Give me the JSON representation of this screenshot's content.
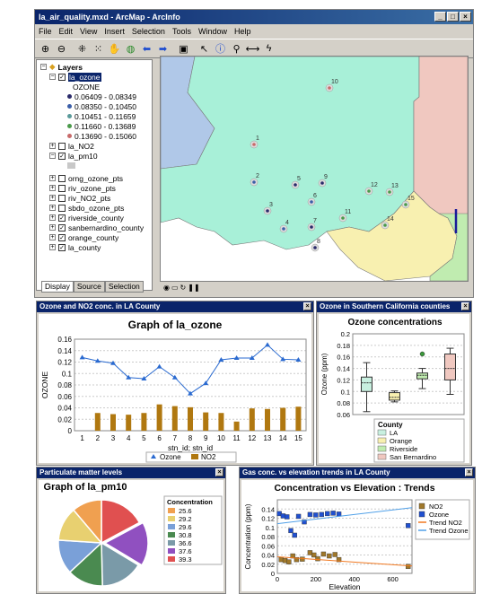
{
  "window": {
    "title": "la_air_quality.mxd - ArcMap - ArcInfo",
    "buttons": [
      "_",
      "□",
      "×"
    ]
  },
  "menu": [
    "File",
    "Edit",
    "View",
    "Insert",
    "Selection",
    "Tools",
    "Window",
    "Help"
  ],
  "toolbar_icons": [
    "zoom-in-icon",
    "zoom-out-icon",
    "fixed-zoom-in-icon",
    "fixed-zoom-out-icon",
    "pan-icon",
    "full-extent-icon",
    "back-icon",
    "forward-icon",
    "bookmark-icon",
    "select-arrow-icon",
    "identify-icon",
    "find-icon",
    "measure-icon",
    "hyperlink-icon"
  ],
  "toc": {
    "root": "Layers",
    "layers": [
      {
        "name": "la_ozone",
        "checked": true,
        "expanded": true,
        "selected": true
      },
      {
        "name": "la_NO2",
        "checked": false,
        "expanded": false
      },
      {
        "name": "la_pm10",
        "checked": true,
        "expanded": true
      },
      {
        "name": "orng_ozone_pts",
        "checked": false,
        "expanded": false
      },
      {
        "name": "riv_ozone_pts",
        "checked": false,
        "expanded": false
      },
      {
        "name": "riv_NO2_pts",
        "checked": false,
        "expanded": false
      },
      {
        "name": "sbdo_ozone_pts",
        "checked": false,
        "expanded": false
      },
      {
        "name": "riverside_county",
        "checked": true,
        "expanded": false
      },
      {
        "name": "sanbernardino_county",
        "checked": true,
        "expanded": false
      },
      {
        "name": "orange_county",
        "checked": true,
        "expanded": false
      },
      {
        "name": "la_county",
        "checked": true,
        "expanded": false
      }
    ],
    "ozone_field": "OZONE",
    "ozone_classes": [
      {
        "label": "0.06409 - 0.08349",
        "color": "#2a2a6a"
      },
      {
        "label": "0.08350 - 0.10450",
        "color": "#3a5ea8"
      },
      {
        "label": "0.10451 - 0.11659",
        "color": "#5a9a9a"
      },
      {
        "label": "0.11660 - 0.13689",
        "color": "#4a9a4a"
      },
      {
        "label": "0.13690 - 0.15060",
        "color": "#c86a6a"
      }
    ],
    "tabs": [
      "Display",
      "Source",
      "Selection"
    ]
  },
  "map": {
    "stations": [
      "1",
      "2",
      "3",
      "4",
      "5",
      "6",
      "7",
      "8",
      "9",
      "10",
      "11",
      "12",
      "13",
      "14",
      "15"
    ],
    "colors": {
      "la": "#a8f0d8",
      "orange": "#f8f0b0",
      "riverside": "#c0ecb0",
      "sanbernardino": "#f0c8c0",
      "west": "#b0c8e8"
    }
  },
  "status_icons": [
    "data-view-icon",
    "layout-view-icon",
    "refresh-icon",
    "pause-icon"
  ],
  "chart_data": [
    {
      "panel_title": "Ozone and NO2 conc. in LA County",
      "type": "line",
      "title": "Graph of la_ozone",
      "xlabel": "stn_id; stn_id",
      "ylabel": "OZONE",
      "categories": [
        "1",
        "2",
        "3",
        "4",
        "5",
        "6",
        "7",
        "8",
        "9",
        "10",
        "11",
        "12",
        "13",
        "14",
        "15"
      ],
      "ylim": [
        0,
        0.16
      ],
      "yticks": [
        "0",
        "0.02",
        "0.04",
        "0.06",
        "0.08",
        "0.1",
        "0.12",
        "0.14",
        "0.16"
      ],
      "series": [
        {
          "name": "Ozone",
          "type": "line",
          "color": "#2a6ad0",
          "values": [
            0.128,
            0.122,
            0.118,
            0.093,
            0.091,
            0.112,
            0.093,
            0.065,
            0.083,
            0.124,
            0.127,
            0.127,
            0.15,
            0.125,
            0.124
          ]
        },
        {
          "name": "NO2",
          "type": "bar",
          "color": "#b07810",
          "values": [
            0,
            0.031,
            0.029,
            0.028,
            0.031,
            0.046,
            0.043,
            0.041,
            0.032,
            0.031,
            0.016,
            0.039,
            0.038,
            0.04,
            0.042
          ]
        }
      ],
      "grid": true,
      "legend": "bottom"
    },
    {
      "panel_title": "Ozone in Southern California counties",
      "type": "box",
      "title": "Ozone concentrations",
      "ylabel": "Ozone (ppm)",
      "ylim": [
        0.06,
        0.2
      ],
      "yticks": [
        "0.06",
        "0.08",
        "0.1",
        "0.12",
        "0.14",
        "0.16",
        "0.18",
        "0.2"
      ],
      "legend_title": "County",
      "legend": "bottom",
      "series": [
        {
          "name": "LA",
          "color": "#c8f0e0",
          "min": 0.065,
          "q1": 0.1,
          "median": 0.115,
          "q3": 0.125,
          "max": 0.15
        },
        {
          "name": "Orange",
          "color": "#f8f0b0",
          "min": 0.082,
          "q1": 0.085,
          "median": 0.09,
          "q3": 0.098,
          "max": 0.101
        },
        {
          "name": "Riverside",
          "color": "#c0ecb0",
          "min": 0.105,
          "q1": 0.122,
          "median": 0.128,
          "q3": 0.132,
          "max": 0.14,
          "outliers": [
            0.165
          ]
        },
        {
          "name": "San Bernardino",
          "color": "#f0c8c0",
          "min": 0.095,
          "q1": 0.12,
          "median": 0.14,
          "q3": 0.165,
          "max": 0.175
        }
      ],
      "grid": true
    },
    {
      "panel_title": "Particulate matter levels",
      "type": "pie",
      "title": "Graph of la_pm10",
      "legend_title": "Concentration",
      "legend": "right",
      "slices": [
        {
          "label": "25.6",
          "value": 25.6,
          "color": "#f0a050"
        },
        {
          "label": "29.2",
          "color": "#e8d070",
          "value": 29.2
        },
        {
          "label": "29.6",
          "color": "#7aa0d8",
          "value": 29.6
        },
        {
          "label": "30.8",
          "color": "#4a8a50",
          "value": 30.8
        },
        {
          "label": "36.6",
          "color": "#7a9aa8",
          "value": 36.6
        },
        {
          "label": "37.6",
          "color": "#9050c0",
          "value": 37.6
        },
        {
          "label": "39.3",
          "color": "#e05050",
          "value": 39.3
        }
      ]
    },
    {
      "panel_title": "Gas conc. vs elevation trends in LA County",
      "type": "scatter",
      "title": "Concentration vs Elevation : Trends",
      "xlabel": "Elevation",
      "ylabel": "Concentration (ppm)",
      "xlim": [
        0,
        700
      ],
      "ylim": [
        0,
        0.16
      ],
      "xticks": [
        "0",
        "200",
        "400",
        "600"
      ],
      "yticks": [
        "0",
        "0.02",
        "0.04",
        "0.06",
        "0.08",
        "0.1",
        "0.12",
        "0.14"
      ],
      "legend": "right",
      "series": [
        {
          "name": "NO2",
          "type": "scatter",
          "color": "#a0782a",
          "points": [
            [
              20,
              0.03
            ],
            [
              40,
              0.028
            ],
            [
              60,
              0.025
            ],
            [
              80,
              0.038
            ],
            [
              100,
              0.03
            ],
            [
              130,
              0.031
            ],
            [
              170,
              0.045
            ],
            [
              190,
              0.04
            ],
            [
              210,
              0.032
            ],
            [
              240,
              0.042
            ],
            [
              270,
              0.038
            ],
            [
              300,
              0.041
            ],
            [
              320,
              0.03
            ],
            [
              680,
              0.015
            ]
          ]
        },
        {
          "name": "Ozone",
          "type": "scatter",
          "color": "#2050d0",
          "points": [
            [
              10,
              0.13
            ],
            [
              30,
              0.125
            ],
            [
              50,
              0.123
            ],
            [
              70,
              0.093
            ],
            [
              90,
              0.083
            ],
            [
              110,
              0.124
            ],
            [
              140,
              0.112
            ],
            [
              170,
              0.128
            ],
            [
              200,
              0.127
            ],
            [
              230,
              0.128
            ],
            [
              260,
              0.13
            ],
            [
              290,
              0.131
            ],
            [
              320,
              0.129
            ],
            [
              680,
              0.104
            ]
          ]
        },
        {
          "name": "Trend NO2",
          "type": "line",
          "color": "#f07820",
          "points": [
            [
              0,
              0.036
            ],
            [
              700,
              0.016
            ]
          ]
        },
        {
          "name": "Trend Ozone",
          "type": "line",
          "color": "#50a0e8",
          "points": [
            [
              0,
              0.108
            ],
            [
              700,
              0.143
            ]
          ]
        }
      ]
    }
  ]
}
